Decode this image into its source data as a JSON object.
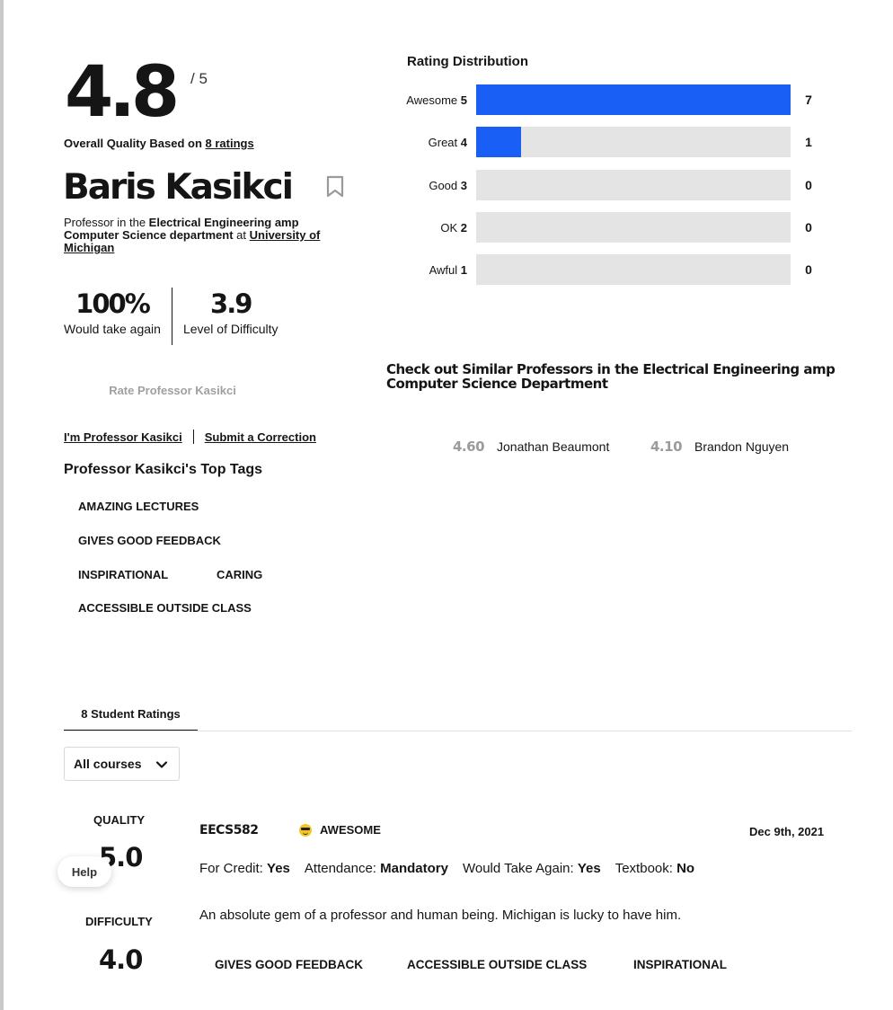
{
  "header": {
    "overall_score": "4.8",
    "out_of": "/ 5",
    "overall_prefix": "Overall Quality Based on ",
    "ratings_link": "8 ratings",
    "name": "Baris Kasikci",
    "dept_prefix": "Professor in the ",
    "dept_name": "Electrical Engineering amp Computer Science department",
    "dept_at": " at ",
    "school": "University of Michigan",
    "would_take_again": "100%",
    "would_take_again_label": "Would take again",
    "difficulty": "3.9",
    "difficulty_label": "Level of Difficulty",
    "rate_button": "Rate Professor Kasikci",
    "claim_link": "I'm Professor Kasikci",
    "correction_link": "Submit a Correction"
  },
  "top_tags": {
    "title": "Professor Kasikci's Top Tags",
    "tags": [
      "AMAZING LECTURES",
      "GIVES GOOD FEEDBACK",
      "INSPIRATIONAL",
      "CARING",
      "ACCESSIBLE OUTSIDE CLASS"
    ]
  },
  "distribution": {
    "title": "Rating Distribution",
    "rows": [
      {
        "label": "Awesome",
        "level": "5",
        "count": "7",
        "fraction": 1.0
      },
      {
        "label": "Great",
        "level": "4",
        "count": "1",
        "fraction": 0.143
      },
      {
        "label": "Good",
        "level": "3",
        "count": "0",
        "fraction": 0
      },
      {
        "label": "OK",
        "level": "2",
        "count": "0",
        "fraction": 0
      },
      {
        "label": "Awful",
        "level": "1",
        "count": "0",
        "fraction": 0
      }
    ],
    "bar_color": "#1a5ff5",
    "track_color": "#e4e4e4"
  },
  "similar": {
    "title": "Check out Similar Professors in the Electrical Engineering amp Computer Science Department",
    "professors": [
      {
        "score": "4.60",
        "name": "Jonathan Beaumont"
      },
      {
        "score": "4.10",
        "name": "Brandon Nguyen"
      }
    ]
  },
  "ratings_section": {
    "tab_label": "8 Student Ratings",
    "course_filter": "All courses",
    "help": "Help"
  },
  "rating": {
    "quality_label": "QUALITY",
    "quality": "5.0",
    "difficulty_label": "DIFFICULTY",
    "difficulty": "4.0",
    "course": "EECS582",
    "emotion": "AWESOME",
    "emotion_icon": "sunglasses-emoji-icon",
    "date": "Dec 9th, 2021",
    "meta": [
      {
        "key": "For Credit: ",
        "value": "Yes"
      },
      {
        "key": "Attendance: ",
        "value": "Mandatory"
      },
      {
        "key": "Would Take Again: ",
        "value": "Yes"
      },
      {
        "key": "Textbook: ",
        "value": "No"
      }
    ],
    "comment": "An absolute gem of a professor and human being. Michigan is lucky to have him.",
    "tags": [
      "GIVES GOOD FEEDBACK",
      "ACCESSIBLE OUTSIDE CLASS",
      "INSPIRATIONAL"
    ]
  }
}
